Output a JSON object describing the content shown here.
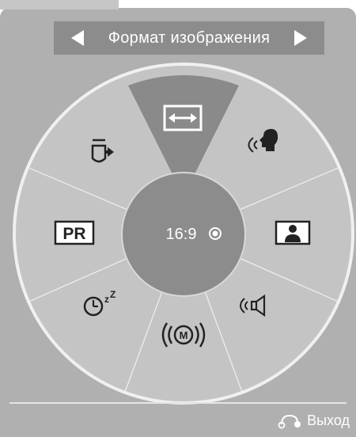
{
  "header": {
    "title": "Формат изображения",
    "prev_icon": "triangle-left-icon",
    "next_icon": "triangle-right-icon"
  },
  "wheel": {
    "center": {
      "value": "16:9",
      "indicator_icon": "radio-selected-icon"
    },
    "items": [
      {
        "id": "aspect-ratio",
        "icon": "arrows-horizontal-icon",
        "selected": true
      },
      {
        "id": "voice",
        "icon": "speaking-head-icon",
        "selected": false
      },
      {
        "id": "picture",
        "icon": "person-picture-icon",
        "selected": false
      },
      {
        "id": "sound",
        "icon": "speaker-icon",
        "selected": false
      },
      {
        "id": "mono",
        "icon": "m-mono-icon",
        "selected": false
      },
      {
        "id": "sleep",
        "icon": "sleep-timer-icon",
        "selected": false
      },
      {
        "id": "pr",
        "icon": "pr-icon",
        "selected": false
      },
      {
        "id": "input",
        "icon": "input-source-icon",
        "selected": false
      }
    ]
  },
  "labels": {
    "pr": "PR",
    "mono": "M",
    "sleep_z": "Z",
    "sleep_z_small": "z"
  },
  "footer": {
    "exit_label": "Выход",
    "exit_icon": "return-arrow-icon"
  },
  "colors": {
    "background": "#b0b0b0",
    "title_bar": "#8c8c8c",
    "wheel_fill": "#c4c4c4",
    "wheel_border": "#f0f0f0",
    "selected_sector": "#8a8a8a",
    "center_disc": "#8c8c8c",
    "icon_color": "#222222"
  }
}
